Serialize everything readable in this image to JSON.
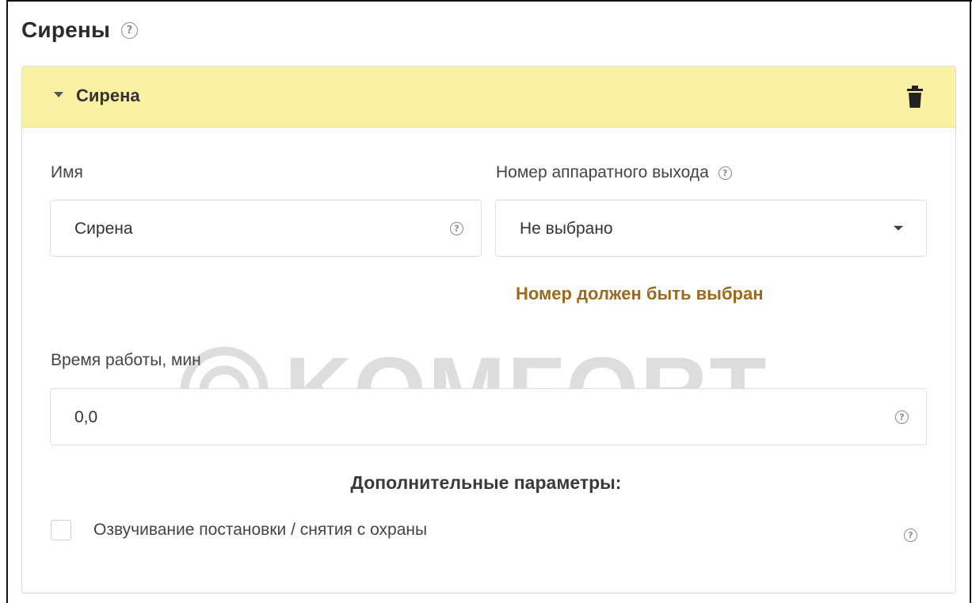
{
  "section": {
    "title": "Сирены",
    "help_icon": "question-circle-icon"
  },
  "card": {
    "title": "Сирена",
    "collapse_icon": "caret-down-icon",
    "delete_icon": "trash-icon",
    "header_color": "#faf1a4"
  },
  "fields": {
    "name": {
      "label": "Имя",
      "value": "Сирена",
      "help_icon": "question-circle-icon"
    },
    "output": {
      "label": "Номер аппаратного выхода",
      "selected": "Не выбрано",
      "help_icon": "question-circle-icon",
      "dropdown_icon": "caret-down-icon",
      "error": "Номер должен быть выбран",
      "error_color": "#9a6a1e"
    },
    "duration": {
      "label": "Время работы, мин",
      "value": "0,0",
      "help_icon": "question-circle-icon"
    }
  },
  "watermark": {
    "text": "KOMFORT"
  },
  "extra": {
    "title": "Дополнительные параметры:",
    "options": [
      {
        "label": "Озвучивание постановки / снятия с охраны",
        "checked": false
      }
    ]
  }
}
